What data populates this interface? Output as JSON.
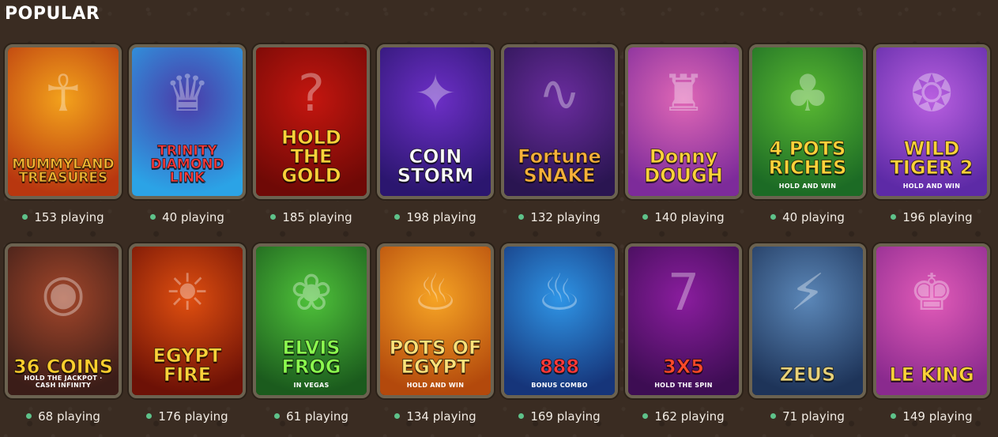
{
  "section": {
    "title": "POPULAR"
  },
  "games": [
    {
      "title": "MUMMYLAND TREASURES",
      "subtitle": "",
      "players": "153 playing",
      "colors": [
        "#f3a21c",
        "#b8370f"
      ],
      "title_color": "#f6b833",
      "icon": "mummy-icon"
    },
    {
      "title": "TRINITY DIAMOND LINK",
      "subtitle": "",
      "players": "40 playing",
      "colors": [
        "#4b3aa8",
        "#2ba3e6"
      ],
      "title_color": "#ff3c3c",
      "icon": "woman-icon"
    },
    {
      "title": "HOLD THE GOLD",
      "subtitle": "",
      "players": "185 playing",
      "colors": [
        "#c4160f",
        "#6f0906"
      ],
      "title_color": "#ffd23a",
      "icon": "question-coin-icon"
    },
    {
      "title": "COIN STORM",
      "subtitle": "",
      "players": "198 playing",
      "colors": [
        "#6d2fc7",
        "#2b166f"
      ],
      "title_color": "#ffffff",
      "icon": "fruit-icon"
    },
    {
      "title": "Fortune SNAKE",
      "subtitle": "",
      "players": "132 playing",
      "colors": [
        "#6a2c9e",
        "#2a1551"
      ],
      "title_color": "#f7b03b",
      "icon": "snake-icon"
    },
    {
      "title": "Donny DOUGH",
      "subtitle": "",
      "players": "140 playing",
      "colors": [
        "#e067b6",
        "#7d2b9a"
      ],
      "title_color": "#ffd23a",
      "icon": "tophat-icon"
    },
    {
      "title": "4 POTS RICHES",
      "subtitle": "HOLD AND WIN",
      "players": "40 playing",
      "colors": [
        "#59b832",
        "#1c6b25"
      ],
      "title_color": "#ffd23a",
      "icon": "leprechaun-icon"
    },
    {
      "title": "WILD TIGER 2",
      "subtitle": "HOLD AND WIN",
      "players": "196 playing",
      "colors": [
        "#b95fe0",
        "#5d2aa6"
      ],
      "title_color": "#ffd23a",
      "icon": "tiger-icon"
    },
    {
      "title": "36 COINS",
      "subtitle": "HOLD THE JACKPOT · CASH INFINITY",
      "players": "68 playing",
      "colors": [
        "#a2462a",
        "#3b1d18"
      ],
      "title_color": "#ffcf2e",
      "icon": "coin-icon"
    },
    {
      "title": "EGYPT FIRE",
      "subtitle": "",
      "players": "176 playing",
      "colors": [
        "#e04f10",
        "#6d1106"
      ],
      "title_color": "#ffd23a",
      "icon": "pharaoh-icon"
    },
    {
      "title": "ELVIS FROG",
      "subtitle": "IN VEGAS",
      "players": "61 playing",
      "colors": [
        "#4fc23a",
        "#1b5b1d"
      ],
      "title_color": "#8cff4f",
      "icon": "frog-icon"
    },
    {
      "title": "POTS OF EGYPT",
      "subtitle": "HOLD AND WIN",
      "players": "134 playing",
      "colors": [
        "#f6a425",
        "#b3490c"
      ],
      "title_color": "#ffe27a",
      "icon": "pot-icon"
    },
    {
      "title": "888",
      "subtitle": "BONUS COMBO",
      "players": "169 playing",
      "colors": [
        "#2f95e6",
        "#16357a"
      ],
      "title_color": "#ff3a3a",
      "icon": "pot-icon"
    },
    {
      "title": "3X5",
      "subtitle": "HOLD THE SPIN",
      "players": "162 playing",
      "colors": [
        "#8a1d9e",
        "#3d0d53"
      ],
      "title_color": "#ff4a2a",
      "icon": "seven-icon"
    },
    {
      "title": "ZEUS",
      "subtitle": "",
      "players": "71 playing",
      "colors": [
        "#5b87b8",
        "#1e3459"
      ],
      "title_color": "#e8d27a",
      "icon": "zeus-icon"
    },
    {
      "title": "LE KING",
      "subtitle": "",
      "players": "149 playing",
      "colors": [
        "#e25bb8",
        "#8a2a8e"
      ],
      "title_color": "#ffd23a",
      "icon": "raccoon-icon"
    }
  ]
}
